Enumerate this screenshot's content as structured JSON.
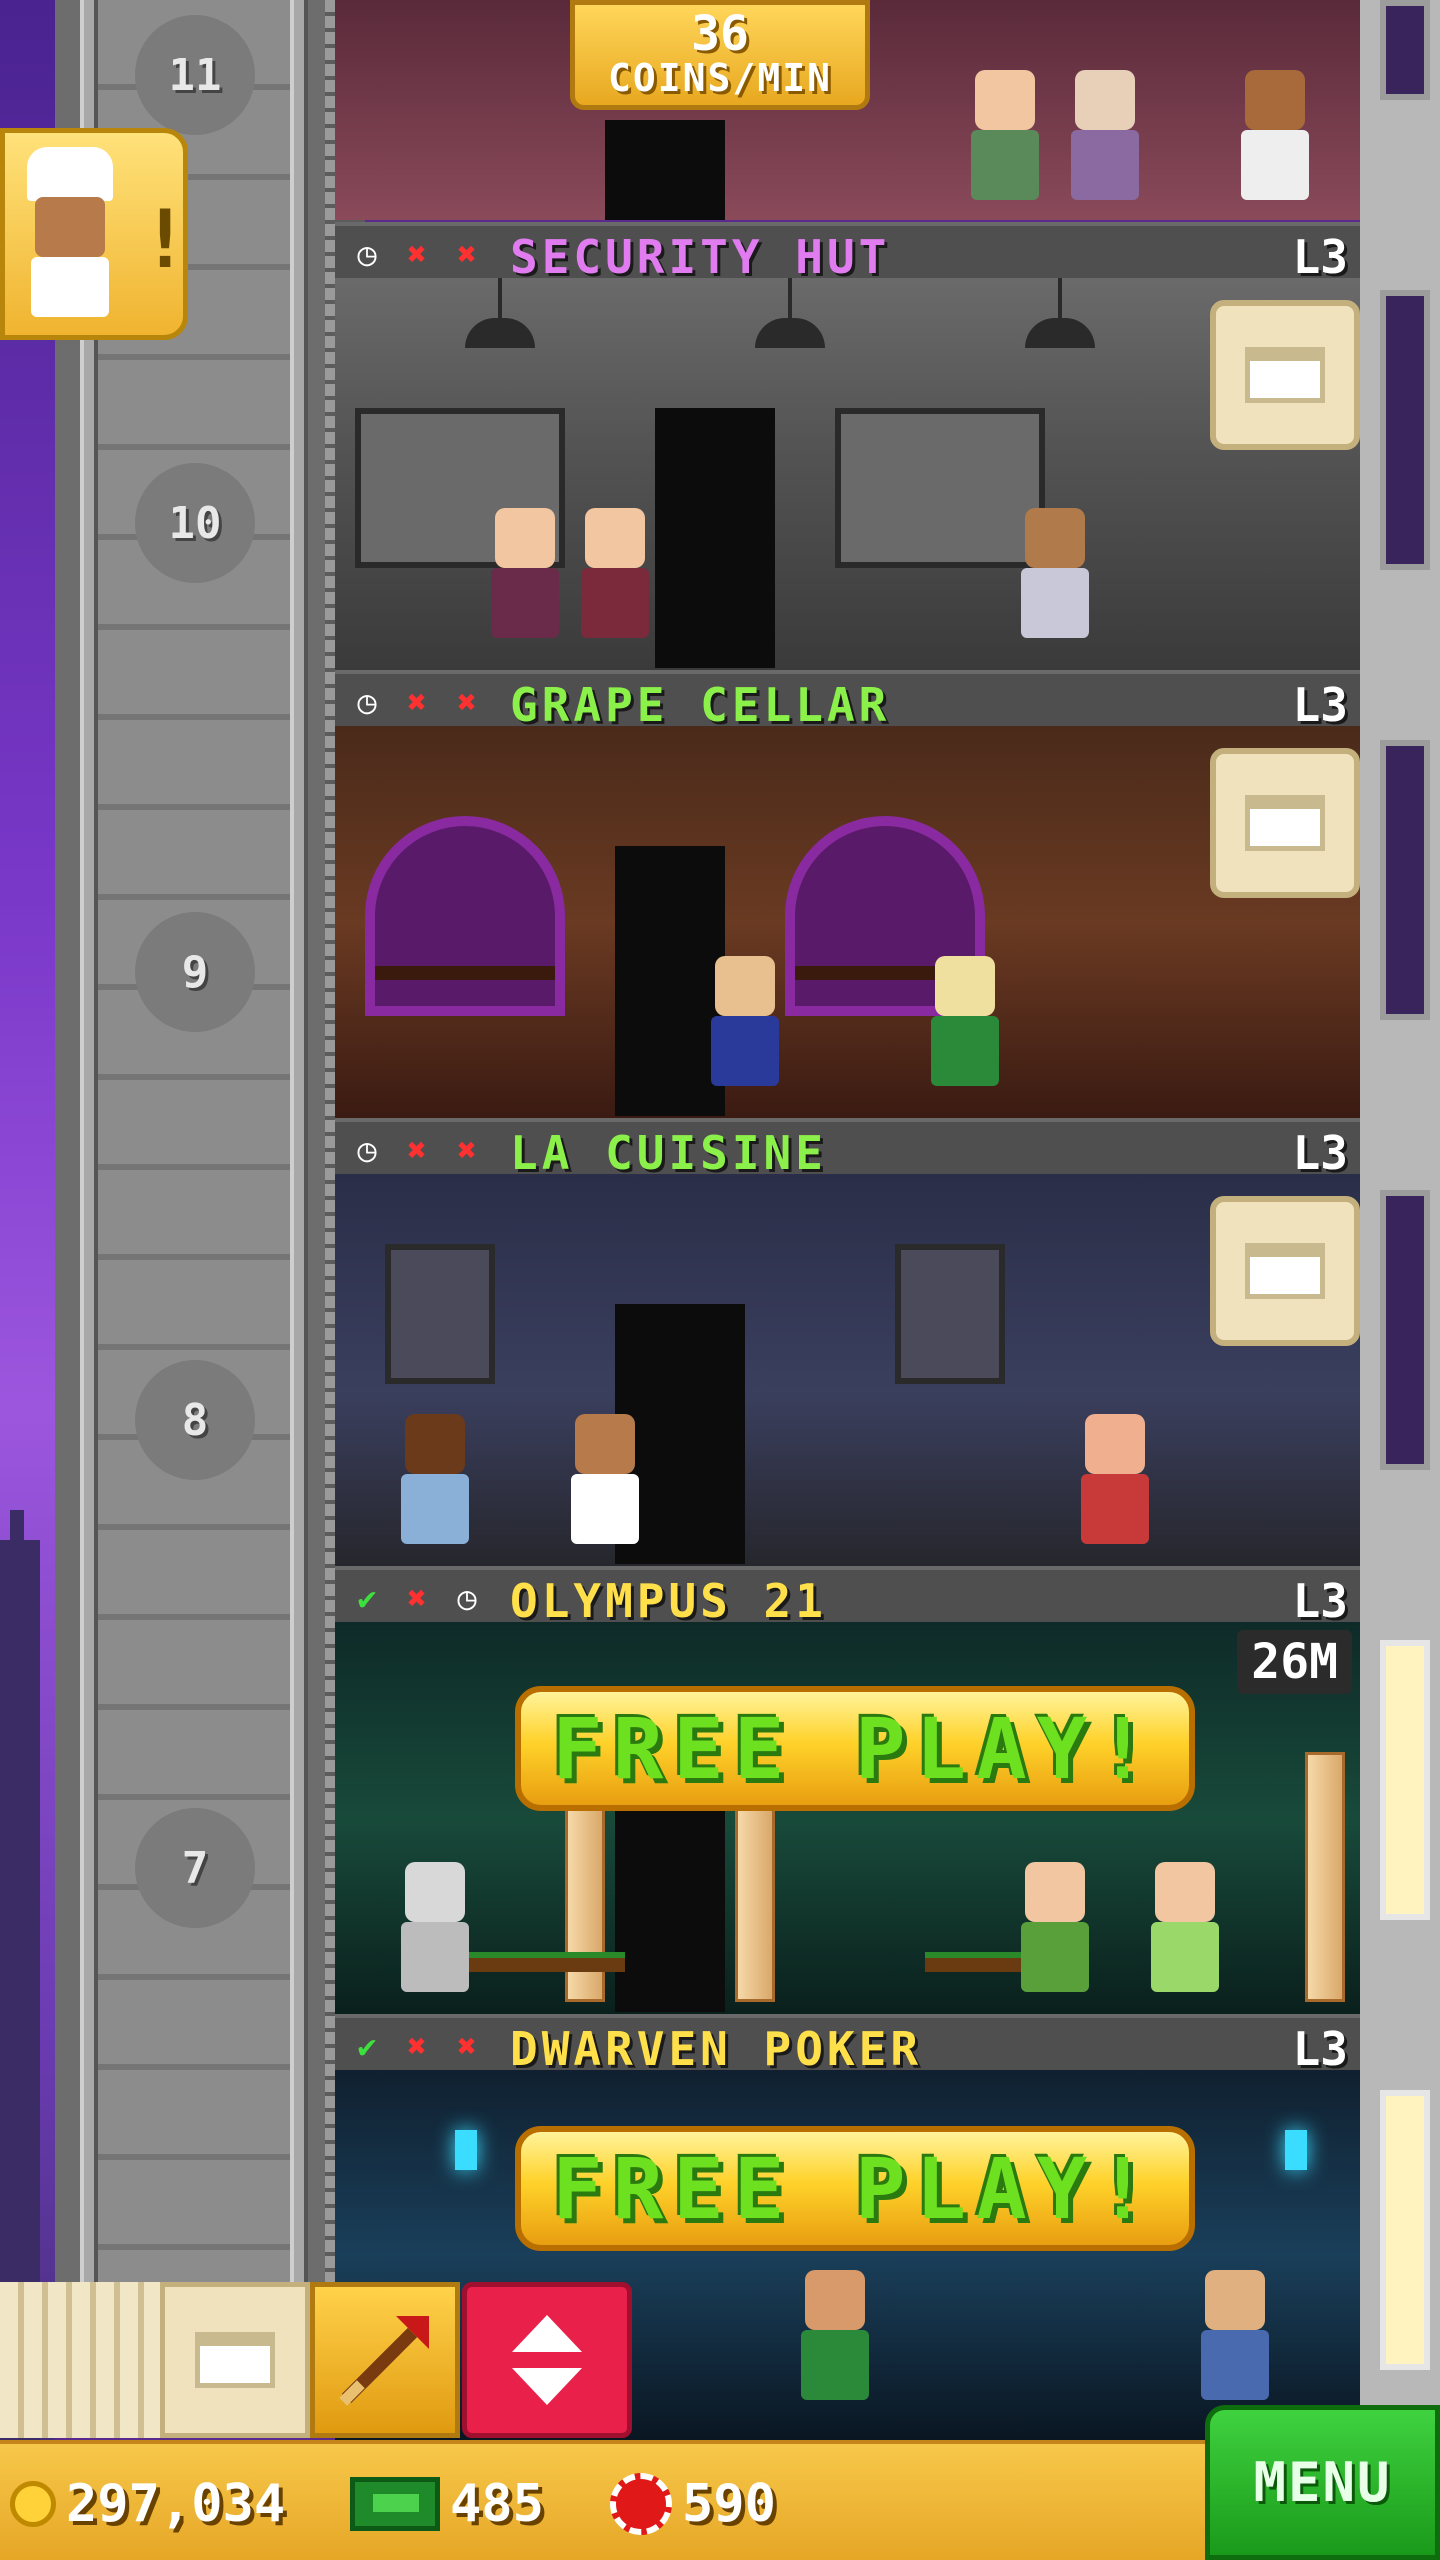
{
  "top_floor": {
    "number": "11",
    "coins_value": "36",
    "coins_unit": "COINS/MIN"
  },
  "notification": {
    "icon": "chef-icon",
    "badge": "!"
  },
  "floors": [
    {
      "name": "SECURITY HUT",
      "level": "L3",
      "number": "10",
      "name_color": "#e07cf0",
      "status": [
        "clock",
        "x",
        "x"
      ]
    },
    {
      "name": "GRAPE CELLAR",
      "level": "L3",
      "number": "9",
      "name_color": "#8cf04a",
      "status": [
        "clock",
        "x",
        "x"
      ]
    },
    {
      "name": "LA CUISINE",
      "level": "L3",
      "number": "8",
      "name_color": "#8cf04a",
      "status": [
        "clock",
        "x",
        "x"
      ]
    },
    {
      "name": "OLYMPUS 21",
      "level": "L3",
      "number": "7",
      "name_color": "#ffe04a",
      "status": [
        "check",
        "x",
        "clock"
      ],
      "earnings": "26M",
      "action": "FREE   PLAY!"
    },
    {
      "name": "DWARVEN POKER",
      "level": "L3",
      "name_color": "#ffe04a",
      "status": [
        "check",
        "x",
        "x"
      ],
      "action": "FREE   PLAY!"
    }
  ],
  "toolbar": {
    "items": [
      "stack-icon",
      "crate-icon",
      "arrow-icon",
      "elevator-icon"
    ]
  },
  "resources": {
    "coins": "297,034",
    "bux": "485",
    "chips": "590"
  },
  "menu_label": "MENU",
  "colors": {
    "accent_gold": "#f7c84a",
    "menu_green": "#2fbf2f",
    "elevator_red": "#e8204a"
  }
}
